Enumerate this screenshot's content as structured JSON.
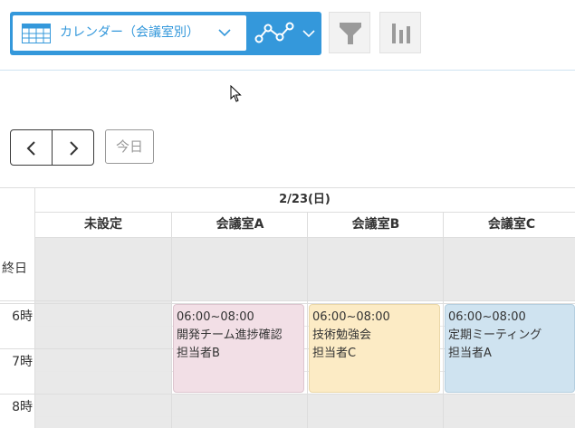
{
  "toolbar": {
    "view_label": "カレンダー（会議室別）",
    "accent_color": "#3498db",
    "icons": {
      "calendar": "calendar-table-icon",
      "view_dropdown": "chevron-down-icon",
      "graph": "line-graph-icon",
      "graph_dropdown": "chevron-down-icon",
      "filter": "funnel-icon",
      "chart": "bar-chart-icon"
    }
  },
  "navigation": {
    "prev_icon": "chevron-left-icon",
    "next_icon": "chevron-right-icon",
    "today_label": "今日"
  },
  "calendar": {
    "date_header": "2/23(日)",
    "columns": [
      "未設定",
      "会議室A",
      "会議室B",
      "会議室C"
    ],
    "allday_label": "終日",
    "hours": [
      "6時",
      "7時",
      "8時"
    ],
    "events": [
      {
        "column": "会議室A",
        "time": "06:00~08:00",
        "title": "開発チーム進捗確認",
        "owner": "担当者B",
        "color": "#f2dfe6"
      },
      {
        "column": "会議室B",
        "time": "06:00~08:00",
        "title": "技術勉強会",
        "owner": "担当者C",
        "color": "#fcebc5"
      },
      {
        "column": "会議室C",
        "time": "06:00~08:00",
        "title": "定期ミーティング",
        "owner": "担当者A",
        "color": "#cfe3f0"
      }
    ]
  }
}
